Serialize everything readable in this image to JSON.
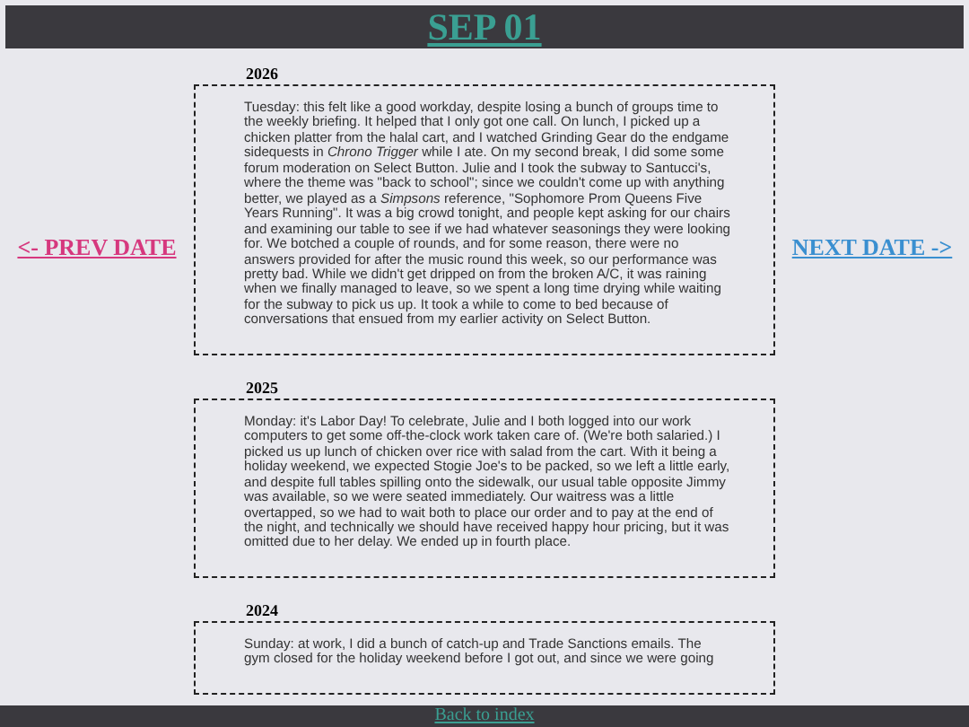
{
  "header": {
    "title": "SEP 01"
  },
  "nav": {
    "prev": "<- PREV DATE",
    "next": "NEXT DATE ->"
  },
  "entries": [
    {
      "year": "2026",
      "text": "Tuesday: this felt like a good workday, despite losing a bunch of groups time to the weekly briefing. It helped that I only got one call. On lunch, I picked up a chicken platter from the halal cart, and I watched Grinding Gear do the endgame sidequests in *Chrono Trigger* while I ate. On my second break, I did some some forum moderation on Select Button. Julie and I took the subway to Santucci's, where the theme was \"back to school\"; since we couldn't come up with anything better, we played as a *Simpsons* reference, \"Sophomore Prom Queens Five Years Running\". It was a big crowd tonight, and people kept asking for our chairs and examining our table to see if we had whatever seasonings they were looking for. We botched a couple of rounds, and for some reason, there were no answers provided for after the music round this week, so our performance was pretty bad. While we didn't get dripped on from the broken A/C, it was raining when we finally managed to leave, so we spent a long time drying while waiting for the subway to pick us up. It took a while to come to bed because of conversations that ensued from my earlier activity on Select Button."
    },
    {
      "year": "2025",
      "text": "Monday: it's Labor Day! To celebrate, Julie and I both logged into our work computers to get some off-the-clock work taken care of. (We're both salaried.) I picked us up lunch of chicken over rice with salad from the cart. With it being a holiday weekend, we expected Stogie Joe's to be packed, so we left a little early, and despite full tables spilling onto the sidewalk, our usual table opposite Jimmy was available, so we were seated immediately. Our waitress was a little overtapped, so we had to wait both to place our order and to pay at the end of the night, and technically we should have received happy hour pricing, but it was omitted due to her delay. We ended up in fourth place."
    },
    {
      "year": "2024",
      "text": "Sunday: at work, I did a bunch of catch-up and Trade Sanctions emails. The gym closed for the holiday weekend before I got out, and since we were going"
    }
  ],
  "footer": {
    "link": "Back to index"
  }
}
